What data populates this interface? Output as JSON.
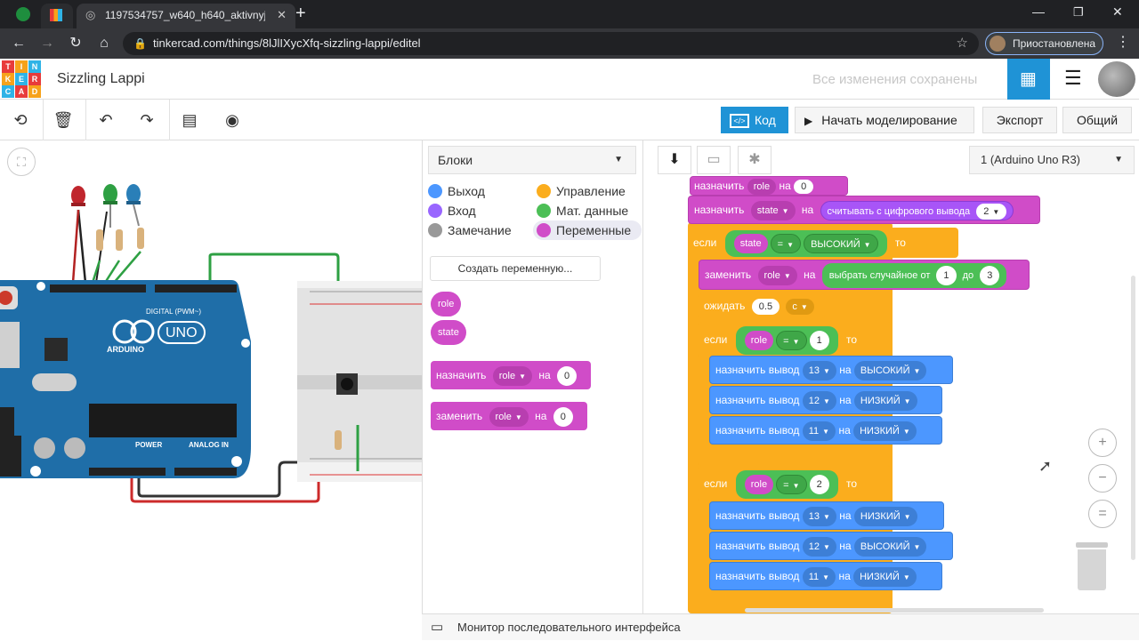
{
  "browser": {
    "tab_title": "1197534757_w640_h640_aktivnyj",
    "new_tab": "+",
    "url": "tinkercad.com/things/8lJlIXycXfq-sizzling-lappi/editel",
    "profile_status": "Приостановлена"
  },
  "header": {
    "logo_letters": [
      "T",
      "I",
      "N",
      "K",
      "E",
      "R",
      "C",
      "A",
      "D"
    ],
    "project_title": "Sizzling Lappi",
    "save_status": "Все изменения сохранены"
  },
  "toolbar": {
    "code_label": "Код",
    "simulate_label": "Начать моделирование",
    "export_label": "Экспорт",
    "share_label": "Общий"
  },
  "blocks_panel": {
    "mode_select": "Блоки",
    "categories": [
      {
        "label": "Выход",
        "color": "#4c97ff"
      },
      {
        "label": "Управление",
        "color": "#fbad1d"
      },
      {
        "label": "Вход",
        "color": "#9966ff"
      },
      {
        "label": "Мат. данные",
        "color": "#4cbf56"
      },
      {
        "label": "Замечание",
        "color": "#999999"
      },
      {
        "label": "Переменные",
        "color": "#d04cc8"
      }
    ],
    "create_variable": "Создать переменную...",
    "variables": [
      "role",
      "state"
    ],
    "set_block": {
      "verb": "назначить",
      "var": "role",
      "to": "на",
      "value": "0"
    },
    "change_block": {
      "verb": "заменить",
      "var": "role",
      "to": "на",
      "value": "0"
    }
  },
  "code_toolbar": {
    "device_select": "1 (Arduino Uno R3)"
  },
  "code": {
    "top_partial": {
      "verb": "назначить",
      "var": "role",
      "to": "на",
      "value": "0"
    },
    "set_state": {
      "verb": "назначить",
      "var": "state",
      "to": "на",
      "reader": "считывать с цифрового вывода",
      "pin": "2"
    },
    "if1": {
      "kw": "если",
      "var": "state",
      "op": "=",
      "value": "ВЫСОКИЙ",
      "then": "то"
    },
    "change_role": {
      "verb": "заменить",
      "var": "role",
      "to": "на",
      "fn": "выбрать случайное от",
      "from": "1",
      "mid": "до",
      "upto": "3"
    },
    "wait": {
      "verb": "ожидать",
      "value": "0.5",
      "unit": "с"
    },
    "if2": {
      "kw": "если",
      "var": "role",
      "op": "=",
      "value": "1",
      "then": "то"
    },
    "if2_body": [
      {
        "verb": "назначить вывод",
        "pin": "13",
        "to": "на",
        "level": "ВЫСОКИЙ"
      },
      {
        "verb": "назначить вывод",
        "pin": "12",
        "to": "на",
        "level": "НИЗКИЙ"
      },
      {
        "verb": "назначить вывод",
        "pin": "11",
        "to": "на",
        "level": "НИЗКИЙ"
      }
    ],
    "if3": {
      "kw": "если",
      "var": "role",
      "op": "=",
      "value": "2",
      "then": "то"
    },
    "if3_body": [
      {
        "verb": "назначить вывод",
        "pin": "13",
        "to": "на",
        "level": "НИЗКИЙ"
      },
      {
        "verb": "назначить вывод",
        "pin": "12",
        "to": "на",
        "level": "ВЫСОКИЙ"
      },
      {
        "verb": "назначить вывод",
        "pin": "11",
        "to": "на",
        "level": "НИЗКИЙ"
      }
    ]
  },
  "circuit": {
    "board_logo": "UNO",
    "board_name": "ARDUINO",
    "digital_label": "DIGITAL (PWM~)",
    "power_label": "POWER",
    "analog_label": "ANALOG IN",
    "led_colors": [
      "#c0262d",
      "#2ea043",
      "#2a7fb8"
    ]
  },
  "serial_monitor": "Монитор последовательного интерфейса",
  "zoom": {
    "in": "+",
    "out": "−",
    "fit": "="
  }
}
